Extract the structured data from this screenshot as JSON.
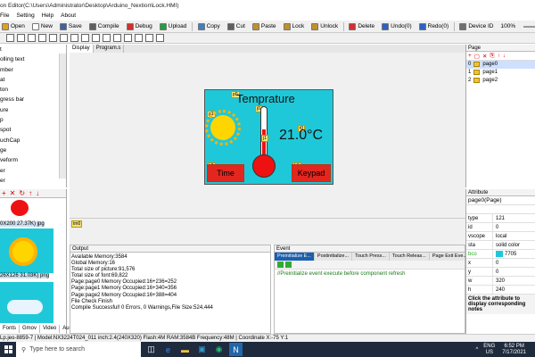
{
  "window": {
    "title": "on Editor(C:\\Users\\Administrator\\Desktop\\Arduino_Nextion\\Lock.HMI)"
  },
  "menu": [
    "File",
    "Setting",
    "Help",
    "About"
  ],
  "toolbar": [
    {
      "label": "Open",
      "icon": "open-icon",
      "color": "#e0a020"
    },
    {
      "label": "New",
      "icon": "new-icon",
      "color": "#ffffff"
    },
    {
      "label": "Save",
      "icon": "save-icon",
      "color": "#4060a0"
    },
    {
      "label": "Compile",
      "icon": "compile-icon",
      "color": "#606060"
    },
    {
      "label": "Debug",
      "icon": "debug-icon",
      "color": "#d03030"
    },
    {
      "label": "Upload",
      "icon": "upload-icon",
      "color": "#20a040"
    },
    {
      "label": "Copy",
      "icon": "copy-icon",
      "color": "#4080c0"
    },
    {
      "label": "Cut",
      "icon": "cut-icon",
      "color": "#606060"
    },
    {
      "label": "Paste",
      "icon": "paste-icon",
      "color": "#c09030"
    },
    {
      "label": "Lock",
      "icon": "lock-icon",
      "color": "#c09030"
    },
    {
      "label": "Unlock",
      "icon": "unlock-icon",
      "color": "#c09030"
    },
    {
      "label": "Delete",
      "icon": "delete-icon",
      "color": "#d03030"
    },
    {
      "label": "Undo(0)",
      "icon": "undo-icon",
      "color": "#3060c0"
    },
    {
      "label": "Redo(0)",
      "icon": "redo-icon",
      "color": "#3060c0"
    },
    {
      "label": "Device ID",
      "icon": "device-icon",
      "color": "#707070"
    }
  ],
  "zoom": {
    "value": "100%",
    "level": 0.55
  },
  "toolbox": {
    "items": [
      "t",
      "olling text",
      "mber",
      "at",
      "ton",
      "gress bar",
      "ure",
      "p",
      "spot",
      "uchCap",
      "ge",
      "veform",
      "er",
      "er"
    ]
  },
  "editor_tabs": [
    {
      "label": "Display"
    },
    {
      "label": "Program.s"
    }
  ],
  "hmi": {
    "title": "Temprature",
    "temp": "21.0°C",
    "btn_time": "Time",
    "btn_keypad": "Keypad",
    "ids": {
      "p0": "p0",
      "t0": "t0",
      "j0": "j0",
      "p1": "p1",
      "t1": "t1",
      "j1": "j1",
      "b0": "b0",
      "b1": "b1",
      "p2": "p2"
    }
  },
  "tm": "tm0",
  "resources": {
    "label1": "0X200 27.37K) jpg",
    "label2": "26X126 31.03K) png",
    "tabs": [
      "Fonts",
      "Gmov",
      "Video",
      "Audio"
    ]
  },
  "output": {
    "title": "Output",
    "lines": [
      "Available Memory:3584",
      "Global Memory:16",
      "Total size of picture:91,576",
      "Total size of font:69,822",
      "Page:page0 Memory Occupied:16+236=252",
      "Page:page1 Memory Occupied:16+340=356",
      "Page:page2 Memory Occupied:16+388=404",
      "File Check Finish",
      "Compile Successful! 0 Errors, 0 Warnings,File Size:524,444"
    ]
  },
  "event": {
    "title": "Event",
    "tabs": [
      "Preinitialize E...",
      "Postinitialize...",
      "Touch Press...",
      "Touch Releas...",
      "Page Exit Eve..."
    ],
    "note": "//Preinitialize event execute before component refresh"
  },
  "pages": {
    "title": "Page",
    "items": [
      {
        "num": "0",
        "name": "page0"
      },
      {
        "num": "1",
        "name": "page1"
      },
      {
        "num": "2",
        "name": "page2"
      }
    ]
  },
  "attribute": {
    "title": "Attribute",
    "selected": "page0(Page)",
    "rows": [
      {
        "k": "type",
        "v": "121"
      },
      {
        "k": "id",
        "v": "0"
      },
      {
        "k": "vscope",
        "v": "local"
      },
      {
        "k": "sta",
        "v": "solid color"
      },
      {
        "k": "bco",
        "v": "7705",
        "swatch": "#1fc8d8"
      },
      {
        "k": "x",
        "v": "0"
      },
      {
        "k": "y",
        "v": "0"
      },
      {
        "k": "w",
        "v": "320"
      },
      {
        "k": "h",
        "v": "240"
      }
    ],
    "hint": "Click the attribute to display corresponding notes"
  },
  "status": {
    "text": "Lp.jeo-8859-7 | Model:NX3224T024_011 inch:2.4(240X320) Flash:4M RAM:3584B Frequency:48M |   Coordinate X:-75 Y:1"
  },
  "taskbar": {
    "search": "Type here to search",
    "lang1": "ENG",
    "lang2": "US",
    "time": "6:52 PM",
    "date": "7/17/2021"
  }
}
